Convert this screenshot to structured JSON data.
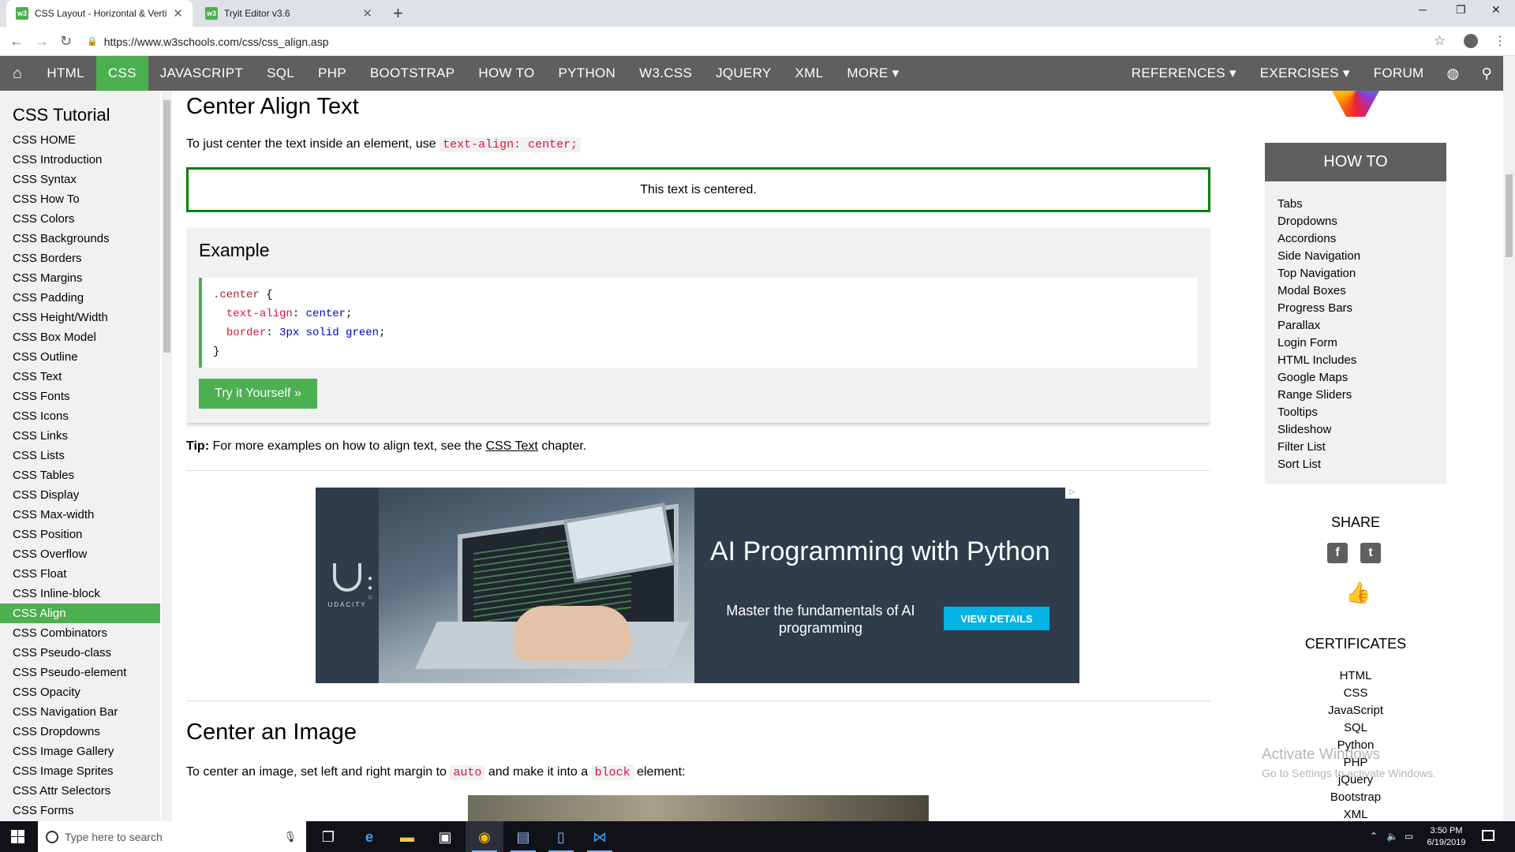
{
  "browser": {
    "tabs": [
      {
        "title": "CSS Layout - Horizontal & Vertic",
        "favicon": "w3"
      },
      {
        "title": "Tryit Editor v3.6",
        "favicon": "w3"
      }
    ],
    "url": "https://www.w3schools.com/css/css_align.asp"
  },
  "topnav": {
    "items": [
      "HTML",
      "CSS",
      "JAVASCRIPT",
      "SQL",
      "PHP",
      "BOOTSTRAP",
      "HOW TO",
      "PYTHON",
      "W3.CSS",
      "JQUERY",
      "XML",
      "MORE ▾"
    ],
    "active": "CSS",
    "right_items": [
      "REFERENCES ▾",
      "EXERCISES ▾",
      "FORUM"
    ]
  },
  "sidebar": {
    "title": "CSS Tutorial",
    "items": [
      "CSS HOME",
      "CSS Introduction",
      "CSS Syntax",
      "CSS How To",
      "CSS Colors",
      "CSS Backgrounds",
      "CSS Borders",
      "CSS Margins",
      "CSS Padding",
      "CSS Height/Width",
      "CSS Box Model",
      "CSS Outline",
      "CSS Text",
      "CSS Fonts",
      "CSS Icons",
      "CSS Links",
      "CSS Lists",
      "CSS Tables",
      "CSS Display",
      "CSS Max-width",
      "CSS Position",
      "CSS Overflow",
      "CSS Float",
      "CSS Inline-block",
      "CSS Align",
      "CSS Combinators",
      "CSS Pseudo-class",
      "CSS Pseudo-element",
      "CSS Opacity",
      "CSS Navigation Bar",
      "CSS Dropdowns",
      "CSS Image Gallery",
      "CSS Image Sprites",
      "CSS Attr Selectors",
      "CSS Forms"
    ],
    "active": "CSS Align"
  },
  "main": {
    "heading1": "Center Align Text",
    "intro_text": "To just center the text inside an element, use",
    "intro_code": "text-align: center;",
    "demo_text": "This text is centered.",
    "example_title": "Example",
    "code": {
      "selector": ".center",
      "brace_open": "{",
      "prop1": "text-align",
      "val1": "center",
      "prop2": "border",
      "val2": "3px solid green",
      "brace_close": "}"
    },
    "try_button": "Try it Yourself »",
    "tip_label": "Tip:",
    "tip_text": "For more examples on how to align text, see the",
    "tip_link": "CSS Text",
    "tip_end": "chapter.",
    "heading2": "Center an Image",
    "img_text_1": "To center an image, set left and right margin to",
    "img_code_1": "auto",
    "img_text_2": "and make it into a",
    "img_code_2": "block",
    "img_text_3": "element:"
  },
  "ad": {
    "brand": "UDACITY",
    "headline": "AI Programming with Python",
    "subtext": "Master the fundamentals of AI programming",
    "cta": "VIEW DETAILS"
  },
  "right": {
    "howto_title": "HOW TO",
    "howto_items": [
      "Tabs",
      "Dropdowns",
      "Accordions",
      "Side Navigation",
      "Top Navigation",
      "Modal Boxes",
      "Progress Bars",
      "Parallax",
      "Login Form",
      "HTML Includes",
      "Google Maps",
      "Range Sliders",
      "Tooltips",
      "Slideshow",
      "Filter List",
      "Sort List"
    ],
    "share_title": "SHARE",
    "certs_title": "CERTIFICATES",
    "certs": [
      "HTML",
      "CSS",
      "JavaScript",
      "SQL",
      "Python",
      "PHP",
      "jQuery",
      "Bootstrap",
      "XML"
    ]
  },
  "watermark": {
    "line1": "Activate Windows",
    "line2": "Go to Settings to activate Windows."
  },
  "taskbar": {
    "search_placeholder": "Type here to search",
    "time": "3:50 PM",
    "date": "6/19/2019"
  }
}
